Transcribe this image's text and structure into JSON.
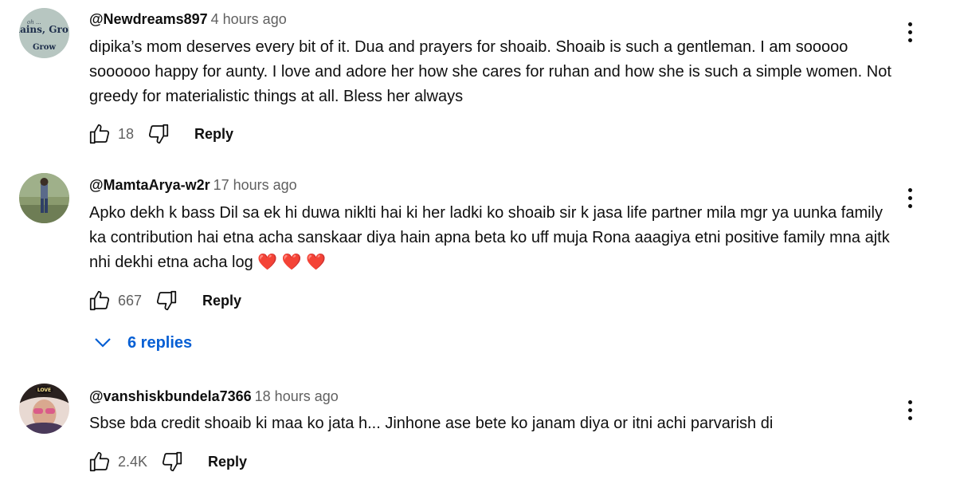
{
  "comments": [
    {
      "author": "@Newdreams897",
      "time": "4 hours ago",
      "text": "dipika’s mom deserves every bit of it. Dua and prayers for shoaib. Shoaib is such a gentleman. I am sooooo soooooo happy for aunty. I love and adore her how she cares for ruhan and how she is such a simple women. Not greedy for materialistic things at all. Bless her always",
      "likes": "18",
      "reply_label": "Reply",
      "avatar_text": "Rains, Grow"
    },
    {
      "author": "@MamtaArya-w2r",
      "time": "17 hours ago",
      "text": "Apko dekh k bass Dil sa ek hi duwa niklti hai ki her ladki ko shoaib sir k jasa life partner mila mgr ya uunka family ka contribution hai etna acha sanskaar diya hain apna beta ko uff muja Rona aaagiya etni positive family mna ajtk nhi dekhi etna acha log",
      "hearts": "❤️ ❤️ ❤️",
      "likes": "667",
      "reply_label": "Reply",
      "replies_label": "6 replies"
    },
    {
      "author": "@vanshiskbundela7366",
      "time": "18 hours ago",
      "text": "Sbse bda credit shoaib ki maa ko jata h... Jinhone ase bete ko  janam diya or itni achi parvarish di",
      "likes": "2.4K",
      "reply_label": "Reply",
      "avatar_text": "LOVE"
    }
  ],
  "colors": {
    "text": "#0f0f0f",
    "secondary": "#606060",
    "link": "#065fd4",
    "heart": "#e0245e"
  },
  "icons": [
    "thumbs-up-icon",
    "thumbs-down-icon",
    "more-vert-icon",
    "chevron-down-icon"
  ]
}
